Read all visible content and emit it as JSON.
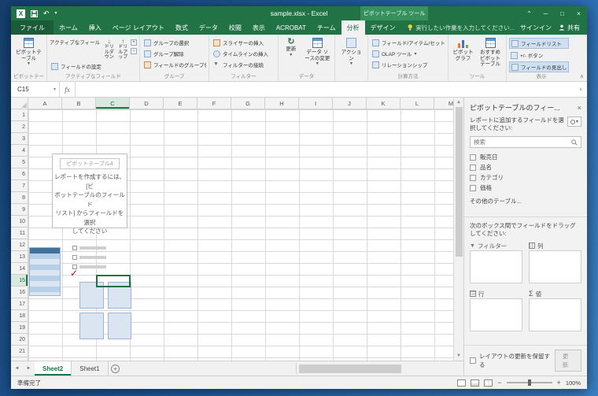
{
  "colors": {
    "accent": "#217346",
    "titlebar": "#217346",
    "context_tab": "#37915e"
  },
  "titlebar": {
    "title": "sample.xlsx - Excel",
    "context_label": "ピボットテーブル ツール"
  },
  "ribbon_tabs": {
    "items": [
      {
        "label": "ファイル",
        "type": "file"
      },
      {
        "label": "ホーム"
      },
      {
        "label": "挿入"
      },
      {
        "label": "ページ レイアウト"
      },
      {
        "label": "数式"
      },
      {
        "label": "データ"
      },
      {
        "label": "校閲"
      },
      {
        "label": "表示"
      },
      {
        "label": "ACROBAT"
      },
      {
        "label": "チーム"
      },
      {
        "label": "分析",
        "active": true
      },
      {
        "label": "デザイン"
      }
    ],
    "tellme": "実行したい作業を入力してください...",
    "signin": "サインイン",
    "share": "共有"
  },
  "ribbon": {
    "pivottable": "ピボットテーブル",
    "active_field_label": "アクティブなフィールド:",
    "field_settings": "フィールドの設定",
    "drill_down": "ドリルダウン",
    "drill_up": "ドリルアップ",
    "group_select": "グループの選択",
    "ungroup": "グループ解除",
    "group_field": "フィールドのグループ化",
    "insert_slicer": "スライサーの挿入",
    "insert_timeline": "タイムラインの挿入",
    "filter_connections": "フィルターの接続",
    "refresh": "更新",
    "change_source": "データ ソースの変更",
    "actions": "アクション",
    "fields_items_sets": "フィールド/アイテム/セット",
    "olap_tools": "OLAP ツール",
    "relationships": "リレーションシップ",
    "pivotchart": "ピボットグラフ",
    "recommended": "おすすめピボットテーブル",
    "field_list": "フィールドリスト",
    "plus_minus": "+/- ボタン",
    "field_headers": "フィールドの見出し",
    "labels": {
      "pivottable": "ピボットテーブル",
      "active_field": "アクティブなフィールド",
      "group": "グループ",
      "filter": "フィルター",
      "data": "データ",
      "calc": "計算方法",
      "tools": "ツール",
      "show": "表示"
    }
  },
  "formula_bar": {
    "name_box": "C15",
    "fx": "fx"
  },
  "sheet": {
    "columns": [
      "A",
      "B",
      "C",
      "D",
      "E",
      "F",
      "G",
      "H",
      "I",
      "J",
      "K",
      "L",
      "M"
    ],
    "rows": [
      "1",
      "2",
      "3",
      "4",
      "5",
      "6",
      "7",
      "8",
      "9",
      "10",
      "11",
      "12",
      "13",
      "14",
      "15",
      "16",
      "17",
      "18",
      "19",
      "20",
      "21"
    ],
    "selected": {
      "column": "C",
      "row": "15",
      "ref": "C15"
    },
    "placeholder": {
      "title": "ピボットテーブル4",
      "lines": [
        "レポートを作成するには、[ピ",
        "ボットテーブルのフィールド",
        "リスト] からフィールドを選択",
        "してください"
      ]
    }
  },
  "sheet_tabs": {
    "tabs": [
      {
        "name": "Sheet2",
        "active": true
      },
      {
        "name": "Sheet1"
      }
    ],
    "add": "+"
  },
  "status_bar": {
    "ready": "準備完了",
    "zoom": "100%"
  },
  "pane": {
    "title": "ピボットテーブルのフィー...",
    "subtitle": "レポートに追加するフィールドを選択してください:",
    "search_placeholder": "検索",
    "fields": [
      "販売日",
      "品名",
      "カテゴリ",
      "価格"
    ],
    "more_tables": "その他のテーブル...",
    "drag_hint": "次のボックス間でフィールドをドラッグしてください:",
    "areas": {
      "filter": "フィルター",
      "columns": "列",
      "rows": "行",
      "values": "値"
    },
    "defer_label": "レイアウトの更新を保留する",
    "update_button": "更新"
  }
}
